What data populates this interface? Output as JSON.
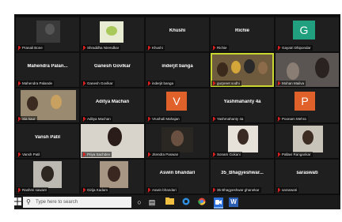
{
  "tiles": [
    {
      "name": "",
      "label": "Pranali Bone"
    },
    {
      "name": "",
      "label": "Shraddha Nirendkar"
    },
    {
      "name": "Khushi",
      "label": "Khushi"
    },
    {
      "name": "Richie",
      "label": "Richie"
    },
    {
      "name": "",
      "initial": "G",
      "label": "Gayatri Dhipondar"
    },
    {
      "name": "Mahendra Palan...",
      "label": "Mahendra Palande"
    },
    {
      "name": "Ganesh Govlkar",
      "label": "Ganesh Govlkar"
    },
    {
      "name": "inderjit banga",
      "label": "inderjit banga"
    },
    {
      "name": "",
      "label": "gurpreet sodhi"
    },
    {
      "name": "",
      "label": "Mohan Mailva"
    },
    {
      "name": "",
      "label": "Sia kaur"
    },
    {
      "name": "Aditya Machan",
      "label": "Aditya Machan"
    },
    {
      "name": "",
      "initial": "V",
      "label": "Vrushali Mahajan"
    },
    {
      "name": "Yashmahanty 4a",
      "label": "Yashmahanty 4a"
    },
    {
      "name": "",
      "initial": "P",
      "label": "Poonam Mehra"
    },
    {
      "name": "Vansh Patil",
      "label": "Vansh Patil"
    },
    {
      "name": "",
      "label": "Priya Sachdev"
    },
    {
      "name": "",
      "label": "Jitendra Paswan"
    },
    {
      "name": "",
      "label": "Sonam Gokani"
    },
    {
      "name": "",
      "label": "Pallavi Rangankar"
    },
    {
      "name": "",
      "label": "Rashmi sawant"
    },
    {
      "name": "",
      "label": "Girija Kadam"
    },
    {
      "name": "Aswin bhandari",
      "label": "Aswin bhandari"
    },
    {
      "name": "35_Bhagyeshwar...",
      "label": "35 Bhagyeshwar ghanekar"
    },
    {
      "name": "saraswati",
      "label": "saraswati"
    }
  ],
  "taskbar": {
    "search_placeholder": "Type here to search",
    "icons": [
      "windows-start",
      "search",
      "task-view",
      "file-explorer",
      "edge",
      "chrome",
      "zoom",
      "word"
    ]
  },
  "colors": {
    "tile_bg": "#1f1f1f",
    "active_border": "#c7d631",
    "mic_muted": "#e02020",
    "avatar_G": "#20a07e",
    "avatar_V": "#e0622a",
    "avatar_P": "#e0622a"
  }
}
